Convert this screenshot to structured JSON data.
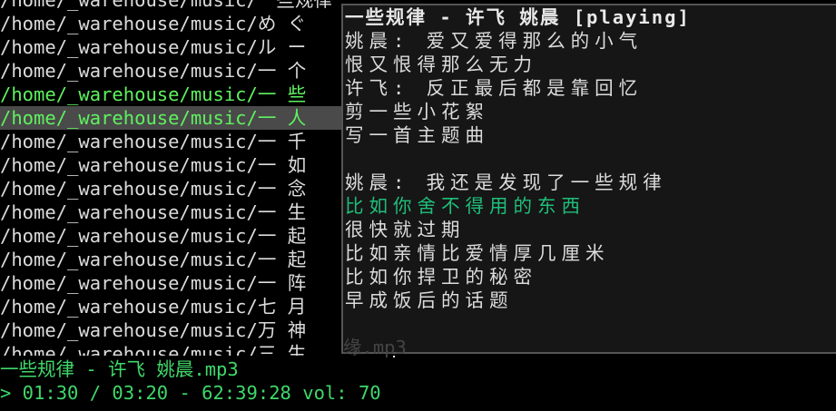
{
  "file_list": {
    "prefix": "/home/_warehouse/music/",
    "items": [
      {
        "name": "一些规律 - 许飞 姚晨 (top clipped)"
      },
      {
        "name": "め ぐ"
      },
      {
        "name": "ル ー"
      },
      {
        "name": "一 个"
      },
      {
        "name": "一 些",
        "state": "playing"
      },
      {
        "name": "一 人",
        "state": "selected"
      },
      {
        "name": "一 千"
      },
      {
        "name": "一 如"
      },
      {
        "name": "一 念"
      },
      {
        "name": "一 生"
      },
      {
        "name": "一 起"
      },
      {
        "name": "一 起"
      },
      {
        "name": "一 阵"
      },
      {
        "name": "七 月"
      },
      {
        "name": "万 神"
      },
      {
        "name": "三 生"
      }
    ]
  },
  "lyrics_panel": {
    "title": "一些规律 - 许飞 姚晨 [playing]",
    "lines": [
      "姚晨: 爱又爱得那么的小气",
      "恨又恨得那么无力",
      "许飞: 反正最后都是靠回忆",
      "剪一些小花絮",
      "写一首主题曲",
      "",
      "姚晨: 我还是发现了一些规律",
      "比如你舍不得用的东西",
      "很快就过期",
      "比如亲情比爱情厚几厘米",
      "比如你捍卫的秘密",
      "早成饭后的话题"
    ],
    "highlight_index": 7
  },
  "faded_overflow": "缘.mp3",
  "status_bar": {
    "current_file": "一些规律 - 许飞 姚晨.mp3",
    "playback": "> 01:30 / 03:20 - 62:39:28 vol: 70"
  }
}
